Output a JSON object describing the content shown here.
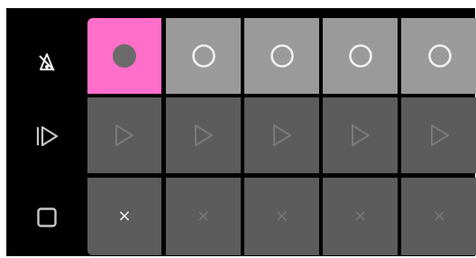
{
  "colors": {
    "panel_bg": "#000000",
    "record_row_bg": "#9a9a9a",
    "record_active_bg": "#ff6ec8",
    "play_row_bg": "#5c5c5c",
    "stop_row_bg": "#5c5c5c",
    "icon_light": "#f0f0f0",
    "icon_dim": "#7b7b7b",
    "icon_dark": "#6b6b6b"
  },
  "sidebar": {
    "items": [
      {
        "icon": "metronome-off-icon"
      },
      {
        "icon": "play-all-icon"
      },
      {
        "icon": "stop-all-icon"
      }
    ]
  },
  "clips": {
    "record_row": [
      {
        "icon": "record-filled-icon",
        "active": true
      },
      {
        "icon": "record-empty-icon",
        "active": false
      },
      {
        "icon": "record-empty-icon",
        "active": false
      },
      {
        "icon": "record-empty-icon",
        "active": false
      },
      {
        "icon": "record-empty-icon",
        "active": false
      }
    ],
    "play_row": [
      {
        "icon": "play-icon"
      },
      {
        "icon": "play-icon"
      },
      {
        "icon": "play-icon"
      },
      {
        "icon": "play-icon"
      },
      {
        "icon": "play-icon"
      }
    ],
    "clear_row": [
      {
        "label": "×",
        "bright": true
      },
      {
        "label": "×",
        "bright": false
      },
      {
        "label": "×",
        "bright": false
      },
      {
        "label": "×",
        "bright": false
      },
      {
        "label": "×",
        "bright": false
      }
    ]
  }
}
